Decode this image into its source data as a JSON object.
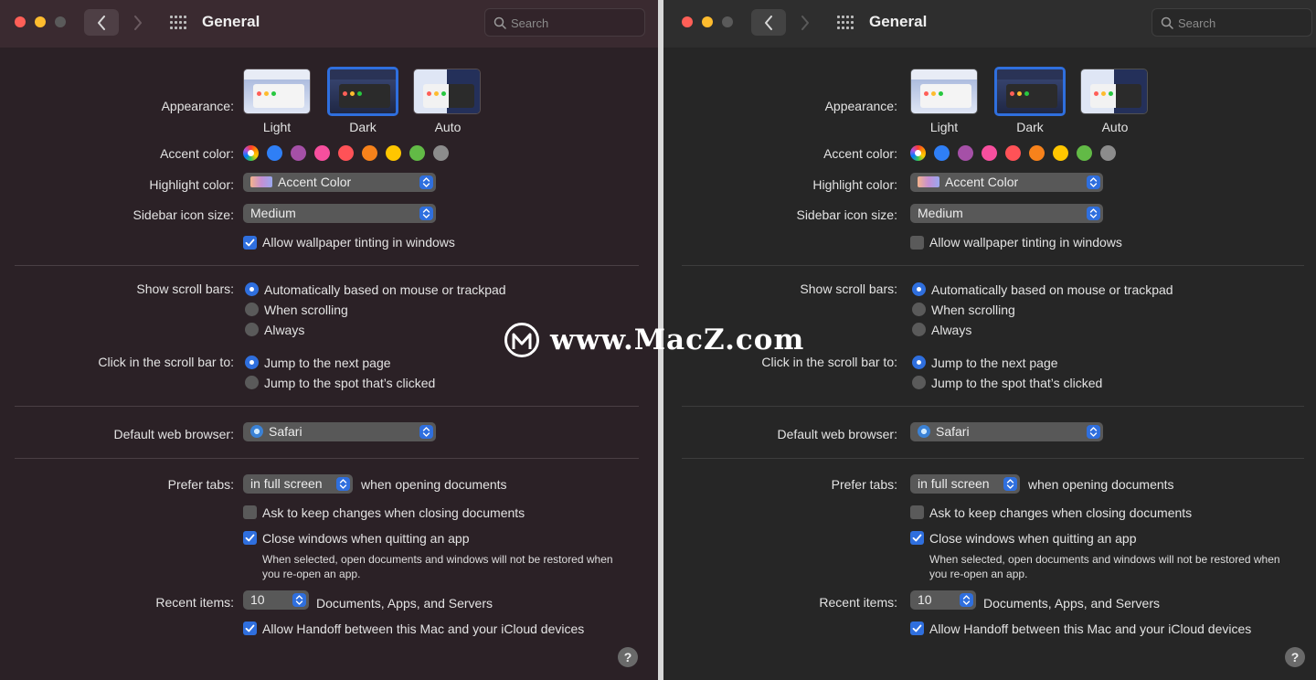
{
  "window": {
    "title": "General",
    "search_placeholder": "Search"
  },
  "appearance": {
    "label": "Appearance:",
    "options": [
      "Light",
      "Dark",
      "Auto"
    ],
    "selected": "Dark"
  },
  "accent": {
    "label": "Accent color:",
    "colors": [
      "multicolor",
      "#2f7ff6",
      "#a550a7",
      "#f74f9e",
      "#ff5257",
      "#f7821b",
      "#ffc600",
      "#62ba46",
      "#8c8c8c"
    ]
  },
  "highlight": {
    "label": "Highlight color:",
    "value": "Accent Color"
  },
  "sidebar_icon": {
    "label": "Sidebar icon size:",
    "value": "Medium"
  },
  "wallpaper_tinting": {
    "label": "Allow wallpaper tinting in windows",
    "left_checked": true,
    "right_checked": false
  },
  "scroll_bars": {
    "label": "Show scroll bars:",
    "options": [
      "Automatically based on mouse or trackpad",
      "When scrolling",
      "Always"
    ],
    "selected": "Automatically based on mouse or trackpad"
  },
  "scroll_click": {
    "label": "Click in the scroll bar to:",
    "options": [
      "Jump to the next page",
      "Jump to the spot that’s clicked"
    ],
    "selected": "Jump to the next page"
  },
  "browser": {
    "label": "Default web browser:",
    "value": "Safari"
  },
  "prefer_tabs": {
    "label": "Prefer tabs:",
    "value": "in full screen",
    "suffix": "when opening documents"
  },
  "ask_keep": {
    "label": "Ask to keep changes when closing documents",
    "checked": false
  },
  "close_windows": {
    "label": "Close windows when quitting an app",
    "checked": true,
    "note": "When selected, open documents and windows will not be restored when you re-open an app."
  },
  "recent_items": {
    "label": "Recent items:",
    "value": "10",
    "suffix": "Documents, Apps, and Servers"
  },
  "handoff": {
    "label": "Allow Handoff between this Mac and your iCloud devices",
    "checked": true
  },
  "help": "?",
  "watermark": "www.MacZ.com",
  "colors": {
    "accent_blue": "#2f6fde",
    "left_bg": "#2b2126",
    "right_bg": "#262626"
  }
}
